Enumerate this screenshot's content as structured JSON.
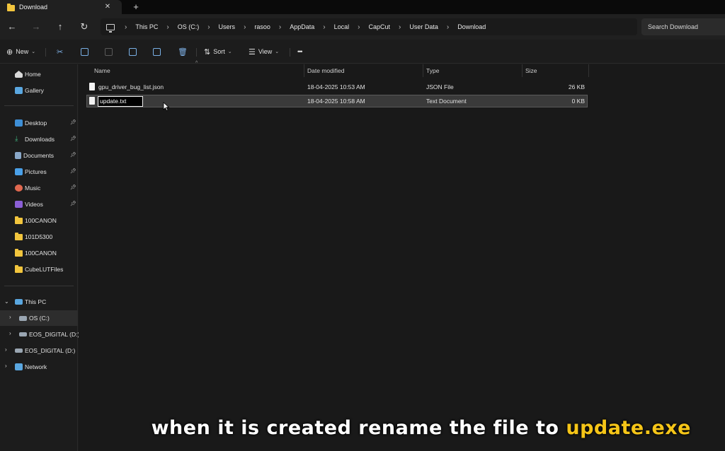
{
  "window": {
    "tab_title": "Download",
    "tab_close": "✕",
    "new_tab": "+"
  },
  "nav": {
    "back": "←",
    "forward": "→",
    "up": "↑",
    "refresh": "↻"
  },
  "breadcrumb": [
    "This PC",
    "OS (C:)",
    "Users",
    "rasoo",
    "AppData",
    "Local",
    "CapCut",
    "User Data",
    "Download"
  ],
  "search": {
    "placeholder": "Search Download"
  },
  "toolbar": {
    "new_label": "New",
    "sort_label": "Sort",
    "view_label": "View",
    "more_label": "•••"
  },
  "sidebar": {
    "quick": [
      {
        "label": "Home",
        "icon": "home-icon"
      },
      {
        "label": "Gallery",
        "icon": "gallery-icon"
      }
    ],
    "pinned": [
      {
        "label": "Desktop",
        "icon": "desktop-icon"
      },
      {
        "label": "Downloads",
        "icon": "downloads-icon"
      },
      {
        "label": "Documents",
        "icon": "documents-icon"
      },
      {
        "label": "Pictures",
        "icon": "pictures-icon"
      },
      {
        "label": "Music",
        "icon": "music-icon"
      },
      {
        "label": "Videos",
        "icon": "videos-icon"
      }
    ],
    "folders": [
      {
        "label": "100CANON"
      },
      {
        "label": "101D5300"
      },
      {
        "label": "100CANON"
      },
      {
        "label": "CubeLUTFiles"
      }
    ],
    "tree": [
      {
        "label": "This PC"
      },
      {
        "label": "OS (C:)"
      },
      {
        "label": "EOS_DIGITAL (D:)"
      },
      {
        "label": "EOS_DIGITAL (D:)"
      },
      {
        "label": "Network"
      }
    ]
  },
  "columns": {
    "name": "Name",
    "date": "Date modified",
    "type": "Type",
    "size": "Size"
  },
  "files": [
    {
      "name": "gpu_driver_bug_list.json",
      "date": "18-04-2025 10:53 AM",
      "type": "JSON File",
      "size": "26 KB"
    },
    {
      "name": "update.txt",
      "date": "18-04-2025 10:58 AM",
      "type": "Text Document",
      "size": "0 KB"
    }
  ],
  "caption": {
    "text": "when it is created rename the file to ",
    "highlight": "update.exe",
    "highlight_color": "#f5c518"
  },
  "colors": {
    "folder": "#f2c53d",
    "accent": "#7fb2e8"
  }
}
